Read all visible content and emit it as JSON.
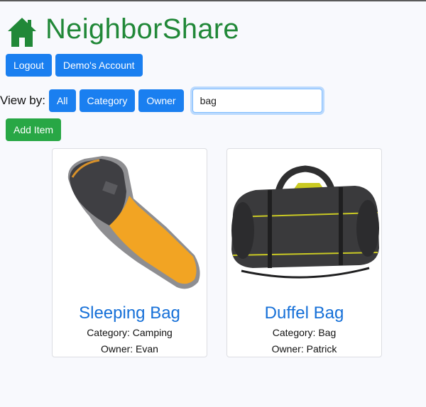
{
  "app": {
    "title": "NeighborShare",
    "brand_color": "#218838",
    "accent_color": "#1a7ff0"
  },
  "account": {
    "logout_label": "Logout",
    "account_label": "Demo's Account"
  },
  "view": {
    "label": "View by:",
    "buttons": [
      "All",
      "Category",
      "Owner"
    ],
    "search_value": "bag"
  },
  "actions": {
    "add_item_label": "Add Item"
  },
  "items": [
    {
      "name": "Sleeping Bag",
      "category": "Category: Camping",
      "owner": "Owner: Evan",
      "icon": "sleeping-bag-image"
    },
    {
      "name": "Duffel Bag",
      "category": "Category: Bag",
      "owner": "Owner: Patrick",
      "icon": "duffel-bag-image"
    }
  ]
}
